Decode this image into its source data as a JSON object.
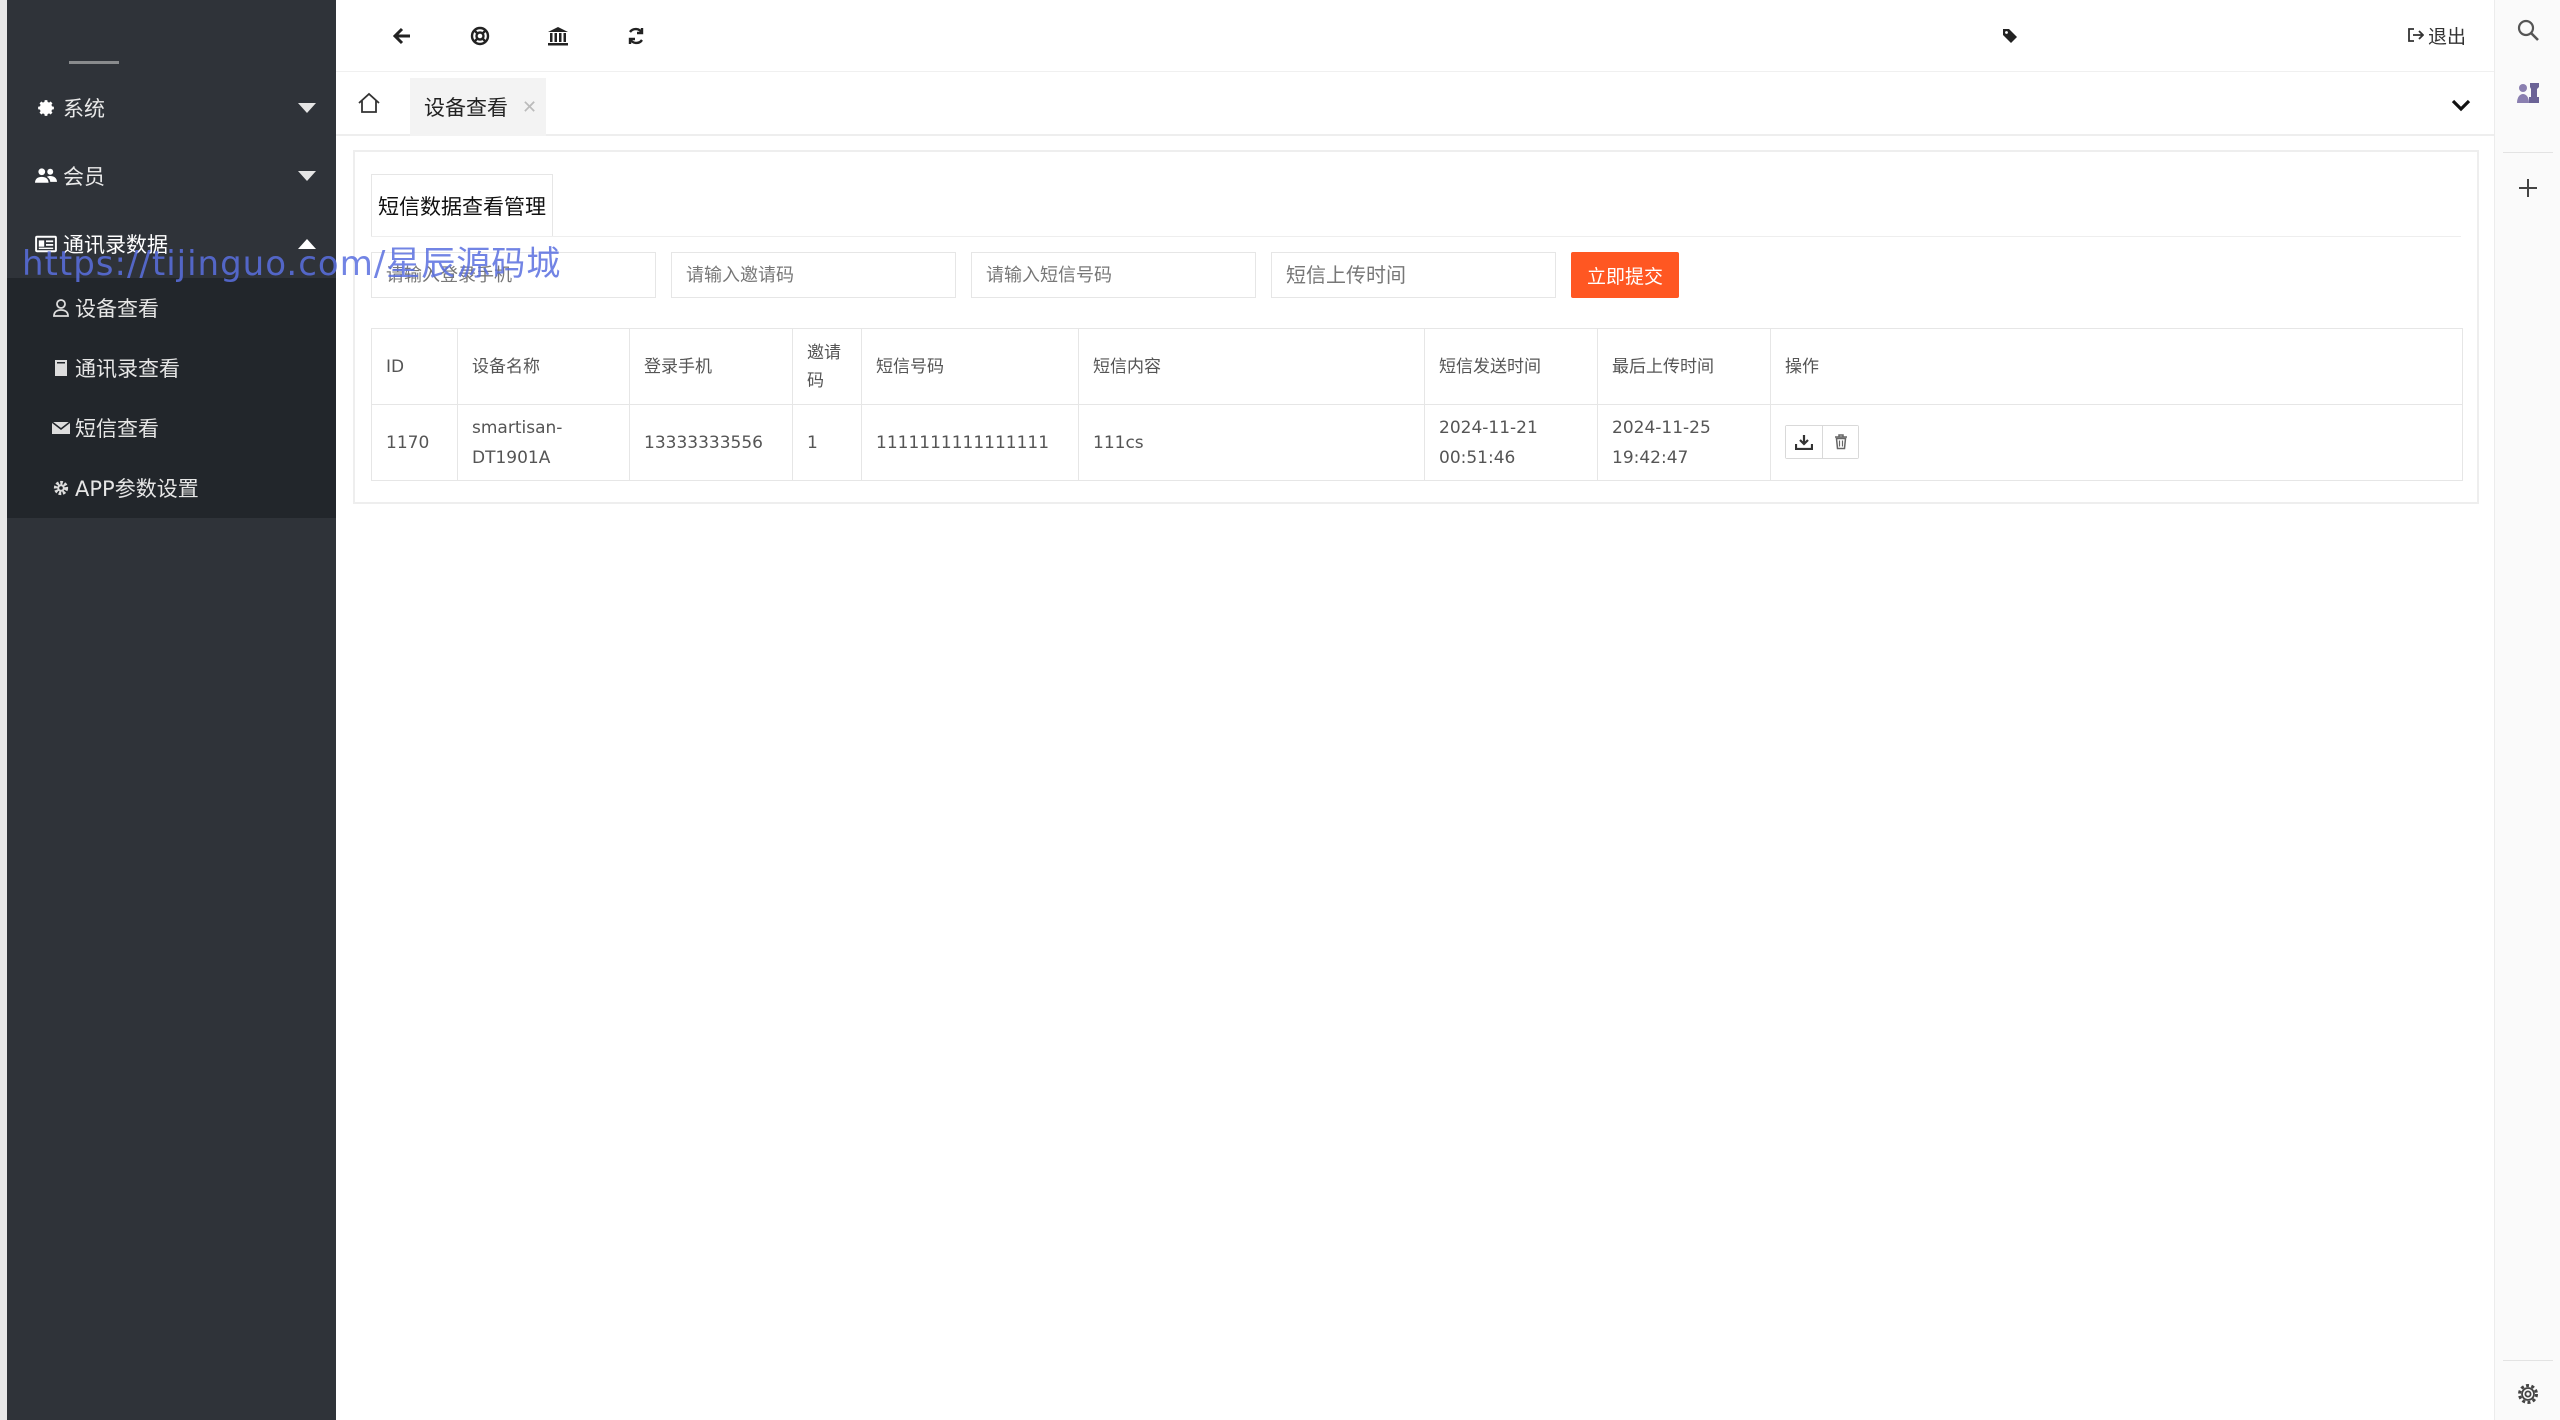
{
  "sidebar": {
    "menus": [
      {
        "label": "系统",
        "icon": "gear-icon"
      },
      {
        "label": "会员",
        "icon": "users-icon"
      },
      {
        "label": "通讯录数据",
        "icon": "id-card-icon"
      }
    ],
    "submenu": [
      {
        "label": "设备查看",
        "icon": "user-icon"
      },
      {
        "label": "通讯录查看",
        "icon": "book-icon"
      },
      {
        "label": "短信查看",
        "icon": "envelope-icon"
      },
      {
        "label": "APP参数设置",
        "icon": "gear-icon"
      }
    ]
  },
  "watermark": "https://tijinguo.com/星辰源码城",
  "header": {
    "logout_label": "退出"
  },
  "tabs": {
    "active_label": "设备查看"
  },
  "panel": {
    "tab_title": "短信数据查看管理",
    "search": {
      "phone_placeholder": "请输入登录手机",
      "invite_placeholder": "请输入邀请码",
      "sms_number_placeholder": "请输入短信号码",
      "upload_time_placeholder": "短信上传时间",
      "submit_label": "立即提交"
    },
    "table": {
      "headers": [
        "ID",
        "设备名称",
        "登录手机",
        "邀请码",
        "短信号码",
        "短信内容",
        "短信发送时间",
        "最后上传时间",
        "操作"
      ],
      "rows": [
        {
          "id": "1170",
          "device_name": "smartisan-DT1901A",
          "login_phone": "13333333556",
          "invite_code": "1",
          "sms_number": "1111111111111111",
          "sms_content": "111cs",
          "send_time": "2024-11-21 00:51:46",
          "upload_time": "2024-11-25 19:42:47"
        }
      ]
    }
  },
  "colors": {
    "sidebar_bg": "#2f3339",
    "submenu_bg": "#22262b",
    "accent": "#ff5722",
    "watermark": "#5a6fe0"
  }
}
